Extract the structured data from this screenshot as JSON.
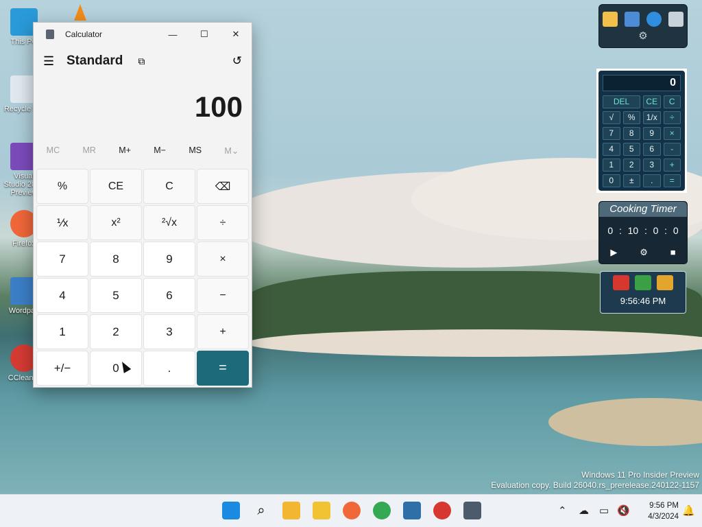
{
  "desktop": {
    "icons": [
      {
        "label": "This PC"
      },
      {
        "label": "Recycle Bin"
      },
      {
        "label": "Visual Studio 2022 Preview"
      },
      {
        "label": "Firefox"
      },
      {
        "label": "Wordpad"
      },
      {
        "label": "CCleaner"
      }
    ]
  },
  "calculator": {
    "window_title": "Calculator",
    "mode": "Standard",
    "display_value": "100",
    "memory": [
      "MC",
      "MR",
      "M+",
      "M−",
      "MS",
      "M⌄"
    ],
    "keys": [
      "%",
      "CE",
      "C",
      "⌫",
      "⅟x",
      "x²",
      "²√x",
      "÷",
      "7",
      "8",
      "9",
      "×",
      "4",
      "5",
      "6",
      "−",
      "1",
      "2",
      "3",
      "+",
      "+/−",
      "0",
      ".",
      "="
    ]
  },
  "gadgets": {
    "calc": {
      "display": "0",
      "keys": [
        "DEL",
        "CE",
        "C",
        "√",
        "%",
        "1/x",
        "÷",
        "7",
        "8",
        "9",
        "×",
        "4",
        "5",
        "6",
        "-",
        "1",
        "2",
        "3",
        "+",
        "0",
        "±",
        ".",
        "="
      ]
    },
    "timer": {
      "title": "Cooking Timer",
      "values": [
        "0",
        ":",
        "10",
        ":",
        "0",
        ":",
        "0"
      ]
    },
    "clock": {
      "time": "9:56:46 PM"
    }
  },
  "watermark": {
    "line1": "Windows 11 Pro Insider Preview",
    "line2": "Evaluation copy. Build 26040.rs_prerelease.240122-1157"
  },
  "taskbar": {
    "time": "9:56 PM",
    "date": "4/3/2024"
  },
  "colors": {
    "accent": "#1d6b7a",
    "taskbar": "#eef1f5"
  }
}
